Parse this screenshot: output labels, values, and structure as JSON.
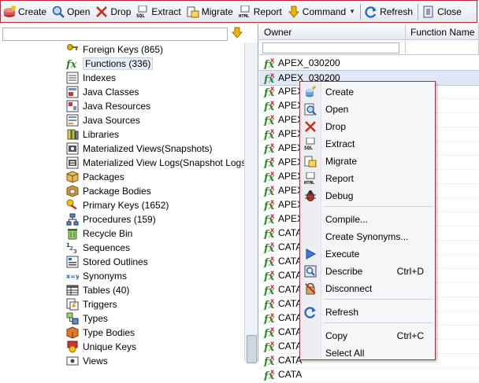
{
  "toolbar": {
    "create": "Create",
    "open": "Open",
    "drop": "Drop",
    "extract": "Extract",
    "migrate": "Migrate",
    "report": "Report",
    "command": "Command",
    "refresh": "Refresh",
    "close": "Close"
  },
  "tree": {
    "filter_value": "",
    "items": [
      {
        "label": "Foreign Keys (865)",
        "icon": "foreign-keys-icon"
      },
      {
        "label": "Functions (336)",
        "icon": "function-icon"
      },
      {
        "label": "Indexes",
        "icon": "index-icon"
      },
      {
        "label": "Java Classes",
        "icon": "java-class-icon"
      },
      {
        "label": "Java Resources",
        "icon": "java-resource-icon"
      },
      {
        "label": "Java Sources",
        "icon": "java-source-icon"
      },
      {
        "label": "Libraries",
        "icon": "library-icon"
      },
      {
        "label": "Materialized Views(Snapshots)",
        "icon": "materialized-view-icon"
      },
      {
        "label": "Materialized View Logs(Snapshot Logs",
        "icon": "materialized-view-log-icon"
      },
      {
        "label": "Packages",
        "icon": "package-icon"
      },
      {
        "label": "Package Bodies",
        "icon": "package-body-icon"
      },
      {
        "label": "Primary Keys (1652)",
        "icon": "primary-key-icon"
      },
      {
        "label": "Procedures (159)",
        "icon": "procedure-icon"
      },
      {
        "label": "Recycle Bin",
        "icon": "recycle-bin-icon"
      },
      {
        "label": "Sequences",
        "icon": "sequence-icon"
      },
      {
        "label": "Stored Outlines",
        "icon": "stored-outline-icon"
      },
      {
        "label": "Synonyms",
        "icon": "synonym-icon"
      },
      {
        "label": "Tables (40)",
        "icon": "table-icon"
      },
      {
        "label": "Triggers",
        "icon": "trigger-icon"
      },
      {
        "label": "Types",
        "icon": "type-icon"
      },
      {
        "label": "Type Bodies",
        "icon": "type-body-icon"
      },
      {
        "label": "Unique Keys",
        "icon": "unique-key-icon"
      },
      {
        "label": "Views",
        "icon": "view-icon"
      }
    ]
  },
  "grid": {
    "columns": [
      "Owner",
      "Function Name"
    ],
    "filter_value": "",
    "rows": [
      "APEX_030200",
      "APEX_030200",
      "APEX",
      "APEX",
      "APEX",
      "APEX",
      "APEX",
      "APEX",
      "APEX",
      "APEX",
      "APEX",
      "APEX",
      "CATA",
      "CATA",
      "CATA",
      "CATA",
      "CATA",
      "CATA",
      "CATA",
      "CATA",
      "CATA",
      "CATA",
      "CATA"
    ]
  },
  "context_menu": {
    "items": [
      {
        "label": "Create",
        "icon": "create-icon",
        "shortcut": ""
      },
      {
        "label": "Open",
        "icon": "open-icon",
        "shortcut": ""
      },
      {
        "label": "Drop",
        "icon": "drop-icon",
        "shortcut": ""
      },
      {
        "label": "Extract",
        "icon": "extract-icon",
        "shortcut": ""
      },
      {
        "label": "Migrate",
        "icon": "migrate-icon",
        "shortcut": ""
      },
      {
        "label": "Report",
        "icon": "report-icon",
        "shortcut": ""
      },
      {
        "label": "Debug",
        "icon": "debug-icon",
        "shortcut": ""
      },
      {
        "label": "Compile...",
        "icon": "",
        "shortcut": ""
      },
      {
        "label": "Create Synonyms...",
        "icon": "",
        "shortcut": ""
      },
      {
        "label": "Execute",
        "icon": "execute-icon",
        "shortcut": ""
      },
      {
        "label": "Describe",
        "icon": "describe-icon",
        "shortcut": "Ctrl+D"
      },
      {
        "label": "Disconnect",
        "icon": "disconnect-icon",
        "shortcut": ""
      },
      {
        "label": "Refresh",
        "icon": "refresh-icon",
        "shortcut": ""
      },
      {
        "label": "Copy",
        "icon": "",
        "shortcut": "Ctrl+C"
      },
      {
        "label": "Select All",
        "icon": "",
        "shortcut": ""
      }
    ]
  },
  "colors": {
    "highlight_border": "#c8242f",
    "function_green": "#2e8b2e",
    "selection": "#dfe8f6"
  }
}
